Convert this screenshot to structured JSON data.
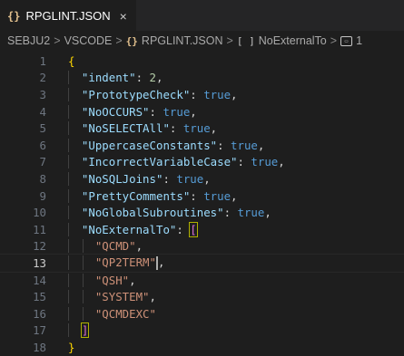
{
  "tab": {
    "icon": "{}",
    "label": "RPGLINT.JSON",
    "close": "×"
  },
  "breadcrumb": {
    "items": [
      "SEBJU2",
      "VSCODE",
      "RPGLINT.JSON",
      "NoExternalTo",
      "1"
    ],
    "json_icon": "{}",
    "array_icon": "[ ]",
    "sep": ">"
  },
  "editor": {
    "lines": [
      {
        "n": "1",
        "t": "{"
      },
      {
        "n": "2",
        "k": "\"indent\"",
        "v": "2",
        "vt": "num"
      },
      {
        "n": "3",
        "k": "\"PrototypeCheck\"",
        "v": "true",
        "vt": "bool"
      },
      {
        "n": "4",
        "k": "\"NoOCCURS\"",
        "v": "true",
        "vt": "bool"
      },
      {
        "n": "5",
        "k": "\"NoSELECTAll\"",
        "v": "true",
        "vt": "bool"
      },
      {
        "n": "6",
        "k": "\"UppercaseConstants\"",
        "v": "true",
        "vt": "bool"
      },
      {
        "n": "7",
        "k": "\"IncorrectVariableCase\"",
        "v": "true",
        "vt": "bool"
      },
      {
        "n": "8",
        "k": "\"NoSQLJoins\"",
        "v": "true",
        "vt": "bool"
      },
      {
        "n": "9",
        "k": "\"PrettyComments\"",
        "v": "true",
        "vt": "bool"
      },
      {
        "n": "10",
        "k": "\"NoGlobalSubroutines\"",
        "v": "true",
        "vt": "bool"
      },
      {
        "n": "11",
        "k": "\"NoExternalTo\"",
        "v": "[",
        "vt": "bracket"
      },
      {
        "n": "12",
        "s": "\"QCMD\"",
        "comma": ","
      },
      {
        "n": "13",
        "s": "\"QP2TERM\"",
        "comma": ",",
        "current": true
      },
      {
        "n": "14",
        "s": "\"QSH\"",
        "comma": ","
      },
      {
        "n": "15",
        "s": "\"SYSTEM\"",
        "comma": ","
      },
      {
        "n": "16",
        "s": "\"QCMDEXC\"",
        "comma": ""
      },
      {
        "n": "17",
        "t": "]"
      },
      {
        "n": "18",
        "t": "}"
      }
    ]
  }
}
